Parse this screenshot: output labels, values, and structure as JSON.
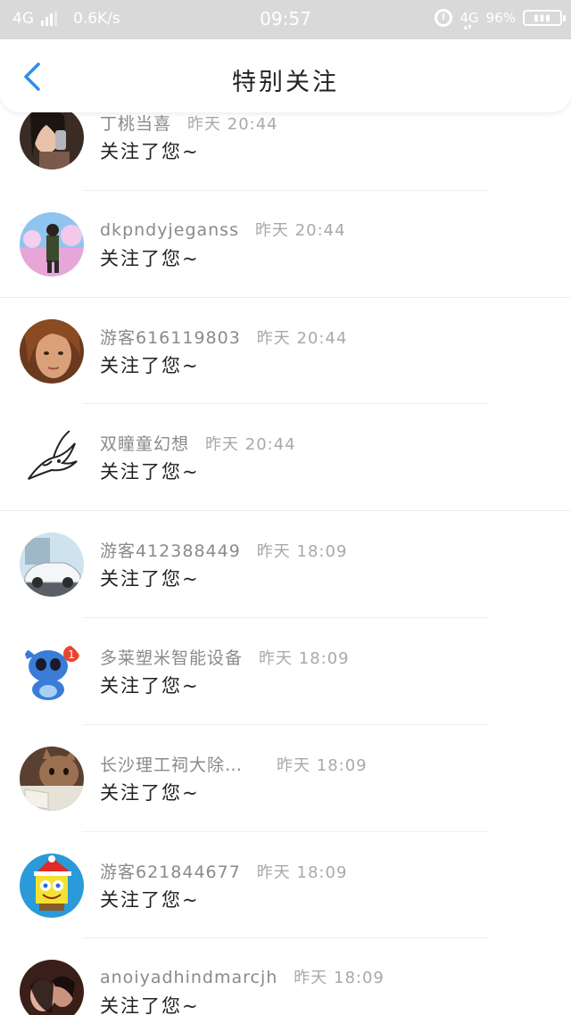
{
  "status_bar": {
    "network_left": "4G",
    "speed": "0.6K/s",
    "time": "09:57",
    "network_right": "4G",
    "battery": "96%"
  },
  "header": {
    "title": "特别关注",
    "back_icon": "chevron-left-icon",
    "accent_color": "#2f8ee8"
  },
  "notifications": [
    {
      "name": "丁桃当喜",
      "time": "昨天 20:44",
      "action": "关注了您~",
      "avatar": "photo-girl"
    },
    {
      "name": "dkpndyjeganss",
      "time": "昨天 20:44",
      "action": "关注了您~",
      "avatar": "anime-boy"
    },
    {
      "name": "游客616119803",
      "time": "昨天 20:44",
      "action": "关注了您~",
      "avatar": "painted-face"
    },
    {
      "name": "双瞳童幻想",
      "time": "昨天 20:44",
      "action": "关注了您~",
      "avatar": "swallow-sketch"
    },
    {
      "name": "游客412388449",
      "time": "昨天 18:09",
      "action": "关注了您~",
      "avatar": "white-car"
    },
    {
      "name": "多莱塑米智能设备",
      "time": "昨天 18:09",
      "action": "关注了您~",
      "avatar": "stitch"
    },
    {
      "name": "长沙理工祠大除…",
      "time": "昨天 18:09",
      "action": "关注了您~",
      "avatar": "cat-photo"
    },
    {
      "name": "游客621844677",
      "time": "昨天 18:09",
      "action": "关注了您~",
      "avatar": "spongebob"
    },
    {
      "name": "anoiyadhindmarcjh",
      "time": "昨天 18:09",
      "action": "关注了您~",
      "avatar": "couple-photo"
    }
  ]
}
